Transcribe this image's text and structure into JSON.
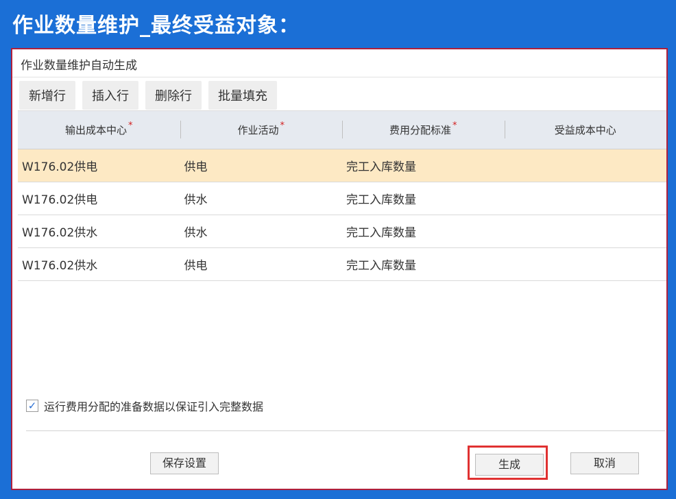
{
  "slide": {
    "title": "作业数量维护_最终受益对象："
  },
  "dialog": {
    "title": "作业数量维护自动生成",
    "toolbar": [
      "新增行",
      "插入行",
      "删除行",
      "批量填充"
    ],
    "columns": [
      "输出成本中心",
      "作业活动",
      "费用分配标准",
      "受益成本中心"
    ],
    "rows": [
      [
        "W176.02供电",
        "供电",
        "完工入库数量",
        ""
      ],
      [
        "W176.02供电",
        "供水",
        "完工入库数量",
        ""
      ],
      [
        "W176.02供水",
        "供水",
        "完工入库数量",
        ""
      ],
      [
        "W176.02供水",
        "供电",
        "完工入库数量",
        ""
      ]
    ],
    "checkbox_label": "运行费用分配的准备数据以保证引入完整数据",
    "checkbox_checked": true,
    "buttons": {
      "save": "保存设置",
      "generate": "生成",
      "cancel": "取消"
    }
  },
  "colors": {
    "slide_bg": "#1b6fd6",
    "selected_row": "#fde9c4",
    "highlight": "#e03131"
  }
}
